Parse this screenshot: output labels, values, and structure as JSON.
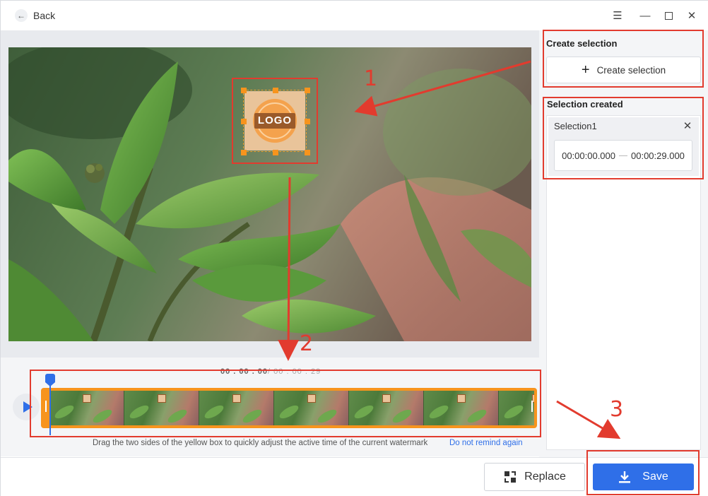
{
  "header": {
    "back_label": "Back",
    "icons": [
      "arrow-left-icon",
      "menu-icon",
      "minimize-icon",
      "maximize-icon",
      "close-icon"
    ]
  },
  "preview": {
    "watermark_logo_text": "LOGO"
  },
  "timeline": {
    "current_time": "00 . 00 . 00",
    "total_time": "/ 00 . 00 . 29",
    "hint": "Drag the two sides of the yellow box to quickly adjust the active time of the current watermark",
    "hint_link": "Do not remind again"
  },
  "right_panel": {
    "create_title": "Create selection",
    "create_button_label": "Create selection",
    "created_title": "Selection created",
    "selections": [
      {
        "name": "Selection1",
        "start": "00:00:00.000",
        "end": "00:00:29.000"
      }
    ]
  },
  "footer": {
    "replace_label": "Replace",
    "save_label": "Save"
  },
  "annotations": {
    "step1": "1",
    "step2": "2",
    "step3": "3"
  },
  "colors": {
    "accent": "#2f6fe8",
    "strip": "#f7941d",
    "callout": "#e23b2e"
  }
}
